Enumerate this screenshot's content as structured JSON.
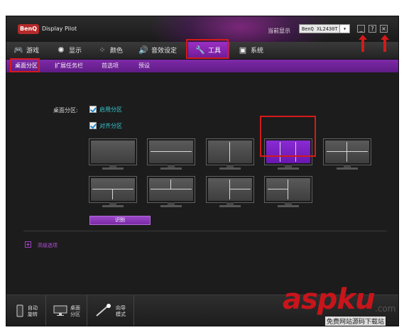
{
  "titlebar": {
    "logo": "BenQ",
    "app_title": "Display Pilot",
    "current_display_label": "当前显示",
    "monitor_select_value": "BenQ XL2430T",
    "buttons": {
      "minimize": "_",
      "help": "?",
      "close": "×"
    }
  },
  "main_nav": {
    "items": [
      {
        "label": "游戏",
        "icon": "gamepad-icon",
        "glyph": "🎮"
      },
      {
        "label": "显示",
        "icon": "brightness-icon",
        "glyph": "✺"
      },
      {
        "label": "颜色",
        "icon": "palette-icon",
        "glyph": "⁘"
      },
      {
        "label": "音效设定",
        "icon": "speaker-icon",
        "glyph": "🔊"
      },
      {
        "label": "工具",
        "icon": "wrench-icon",
        "glyph": "🔧",
        "active": true
      },
      {
        "label": "系统",
        "icon": "system-icon",
        "glyph": "▣"
      }
    ]
  },
  "sub_nav": {
    "items": [
      {
        "label": "桌面分区",
        "active": true
      },
      {
        "label": "扩展任务栏"
      },
      {
        "label": "首选项"
      },
      {
        "label": "预设"
      }
    ]
  },
  "content": {
    "section_label": "桌面分区:",
    "enable_partition": {
      "label": "启用分区",
      "checked": true
    },
    "align_partition": {
      "label": "对齐分区",
      "checked": true
    },
    "identify_button": "识别",
    "advanced_options": "高级选项",
    "layouts": [
      {
        "name": "full"
      },
      {
        "name": "two-rows"
      },
      {
        "name": "two-cols"
      },
      {
        "name": "three-cols",
        "selected": true
      },
      {
        "name": "quad"
      },
      {
        "name": "top-one-bottom-two"
      },
      {
        "name": "top-two-bottom-one"
      },
      {
        "name": "left-one-right-two"
      },
      {
        "name": "left-two-right-one"
      }
    ]
  },
  "bottom_bar": {
    "items": [
      {
        "label_line1": "自动",
        "label_line2": "旋转",
        "icon": "rotate-monitor-icon"
      },
      {
        "label_line1": "桌面",
        "label_line2": "分区",
        "icon": "desktop-partition-icon"
      },
      {
        "label_line1": "向导",
        "label_line2": "模式",
        "icon": "wizard-wand-icon"
      }
    ]
  },
  "watermark": {
    "brand": "aspku",
    "suffix": ".com",
    "tagline": "免费网站源码下载站"
  },
  "colors": {
    "accent_purple": "#7b2aa6",
    "highlight_red": "#d41a1a",
    "teal_text": "#36c7d0"
  }
}
